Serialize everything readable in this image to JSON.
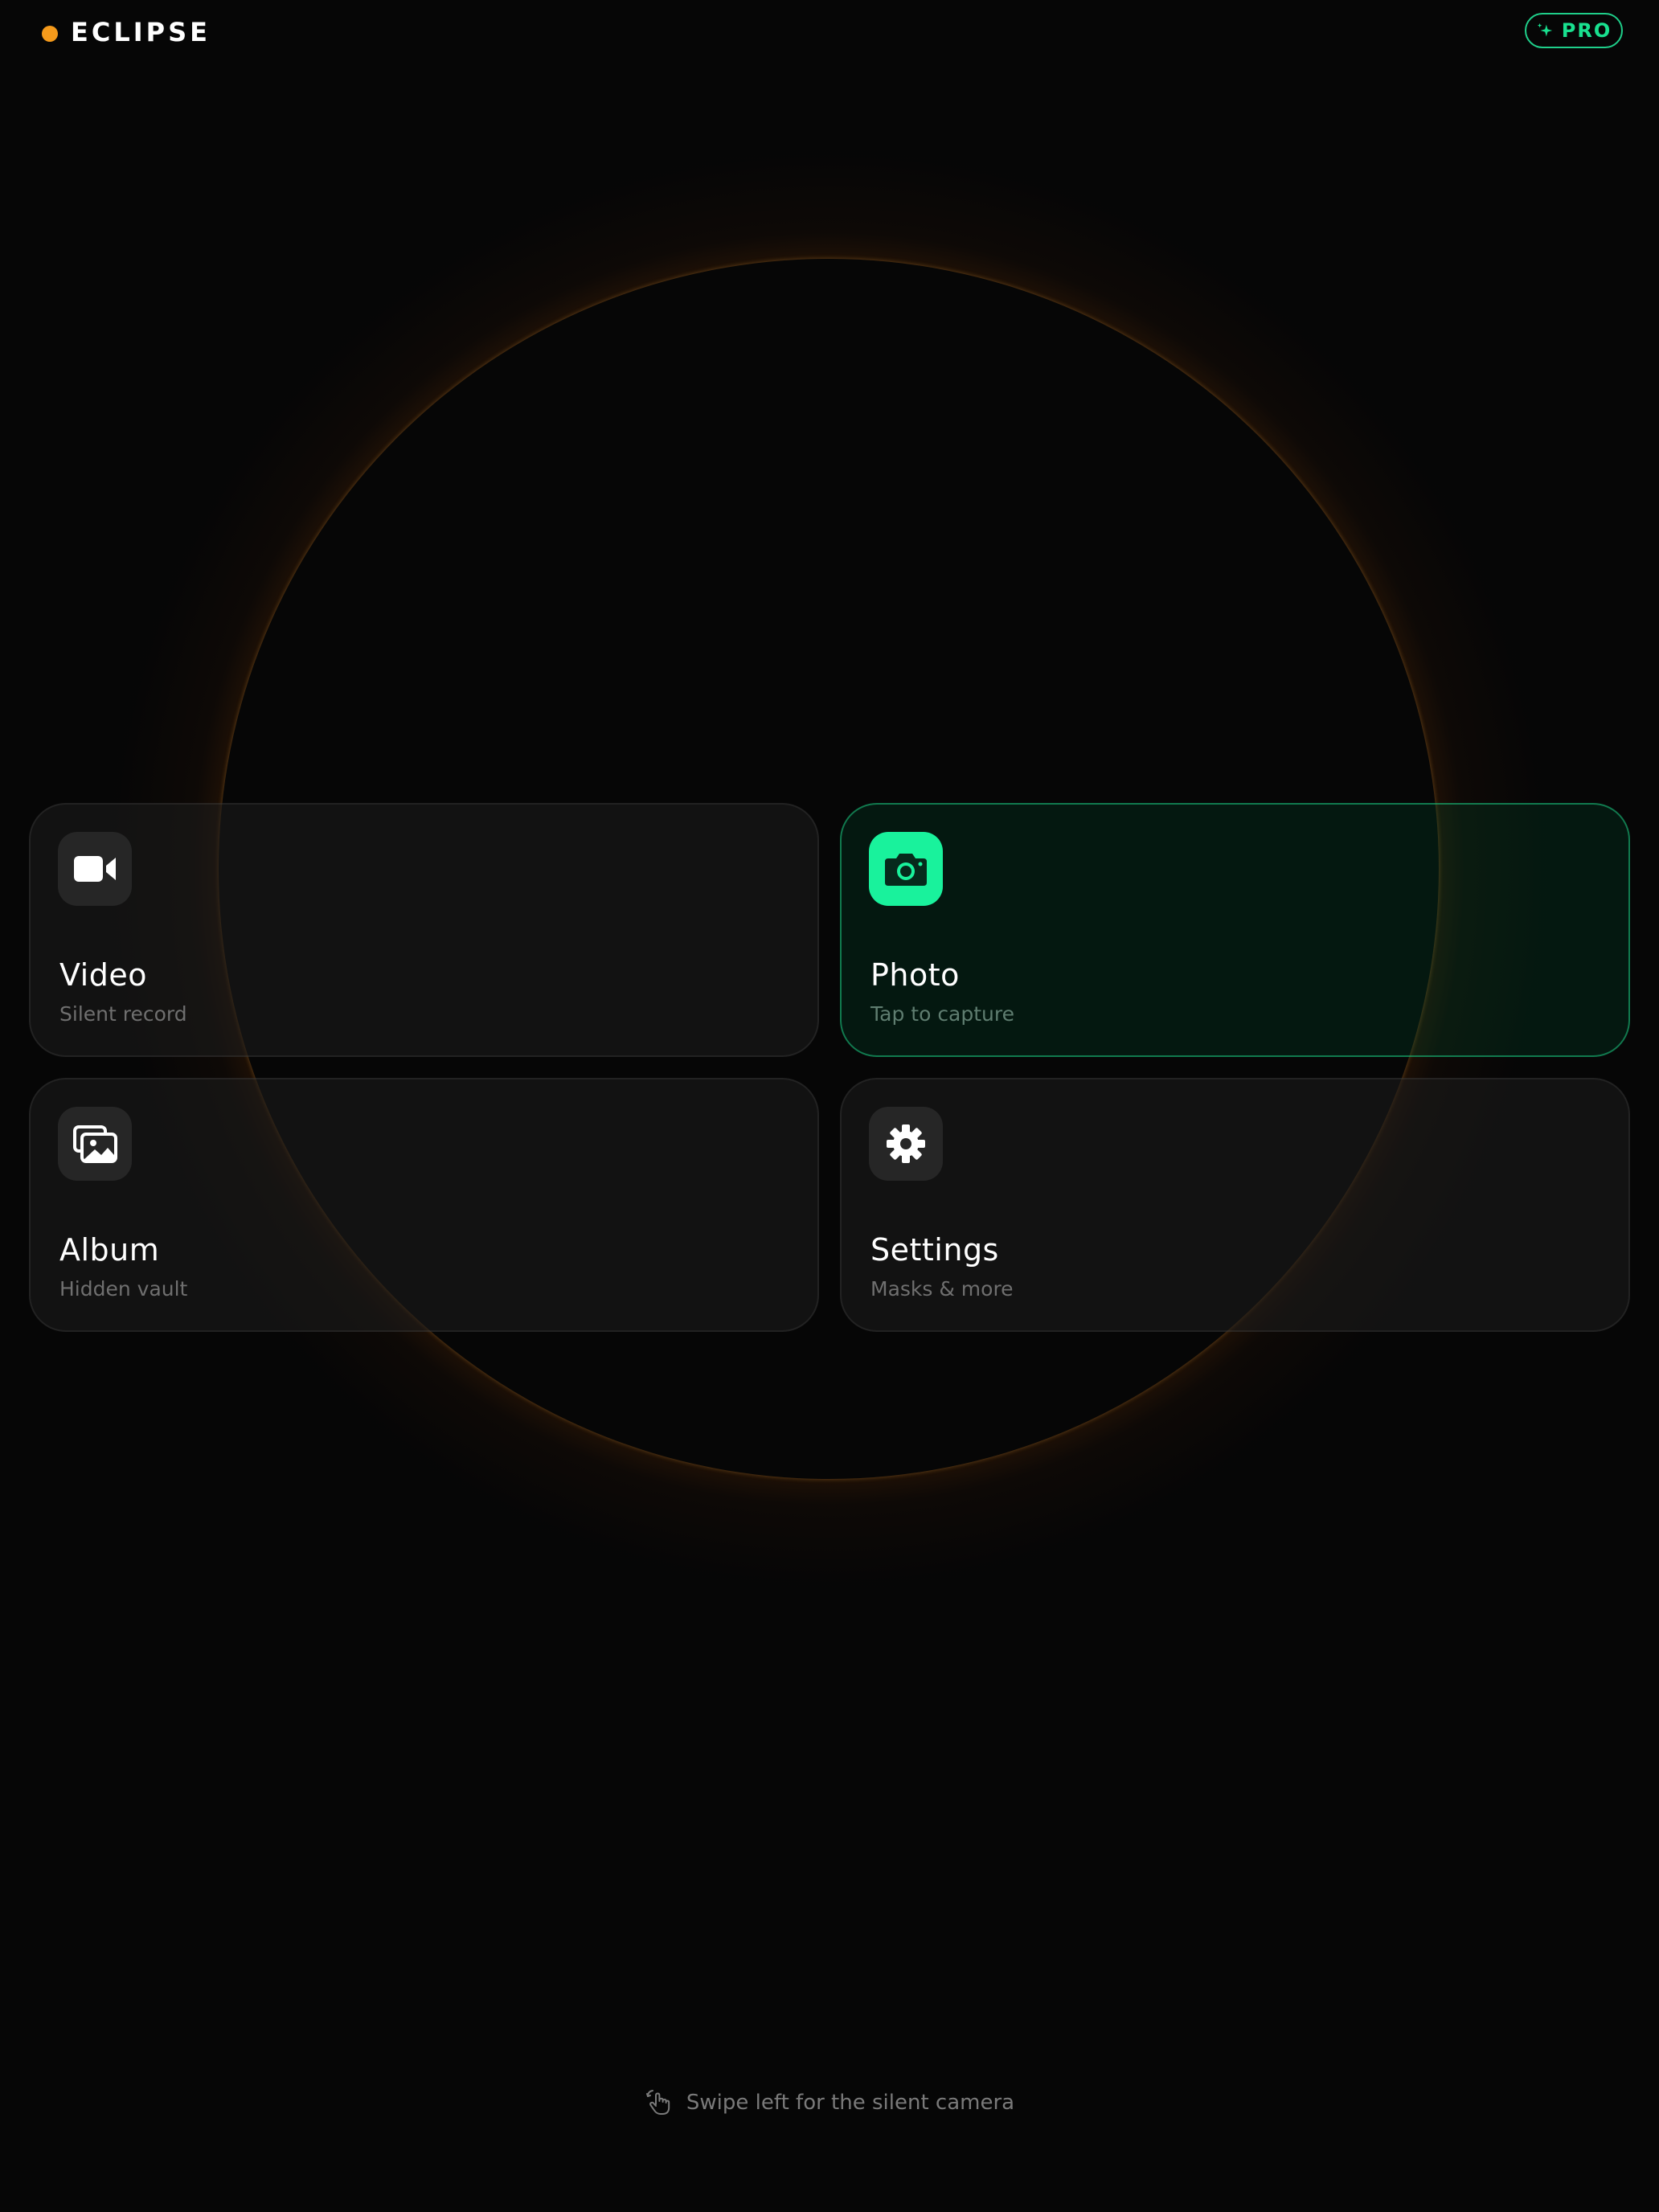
{
  "app": {
    "brand": "ECLIPSE",
    "pro_label": "PRO",
    "accent_color": "#19f29c",
    "brand_dot_color": "#f59a1b",
    "corona_color": "#f59114"
  },
  "cards": [
    {
      "title": "Video",
      "subtitle": "Silent record",
      "icon": "video-camera-icon",
      "active": false
    },
    {
      "title": "Photo",
      "subtitle": "Tap to capture",
      "icon": "camera-icon",
      "active": true
    },
    {
      "title": "Album",
      "subtitle": "Hidden vault",
      "icon": "photo-album-icon",
      "active": false
    },
    {
      "title": "Settings",
      "subtitle": "Masks & more",
      "icon": "gear-icon",
      "active": false
    }
  ],
  "footer": {
    "hint": "Swipe left for the silent camera",
    "icon": "swipe-hand-icon"
  }
}
